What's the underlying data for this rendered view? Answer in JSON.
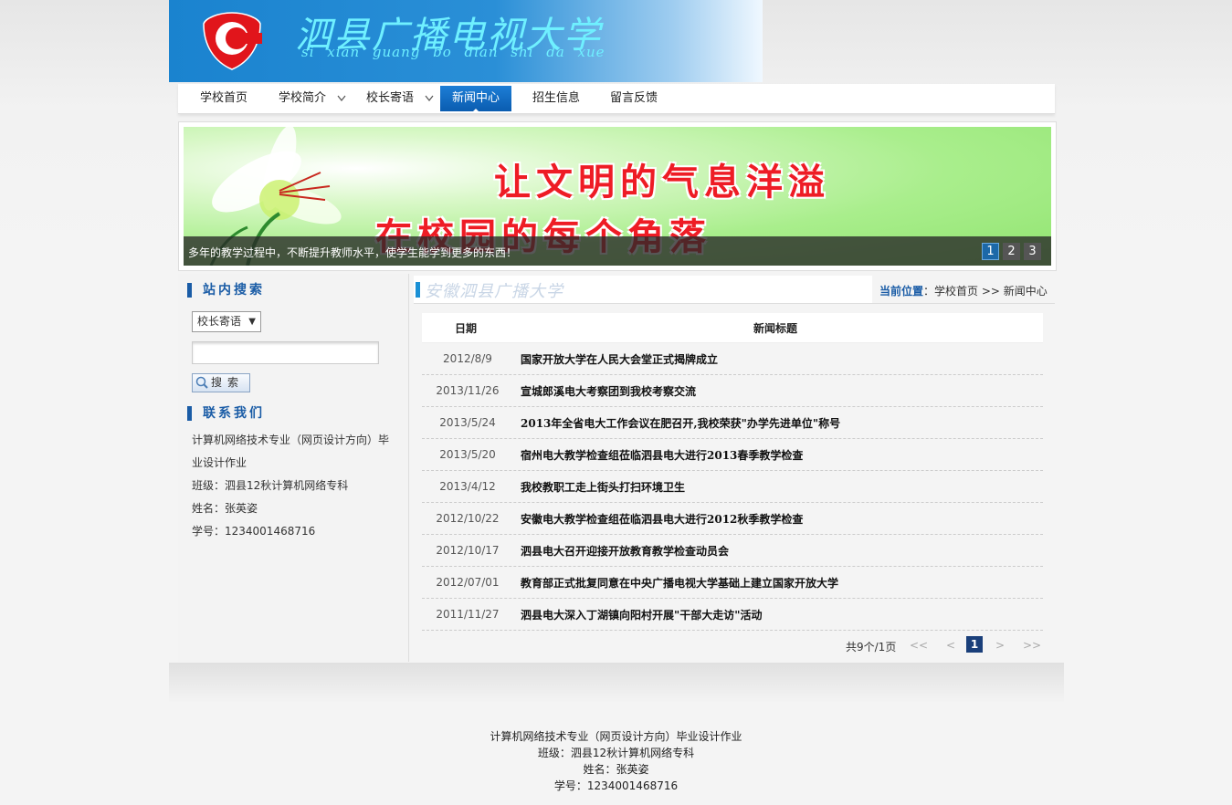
{
  "header": {
    "title": "泗县广播电视大学",
    "subtitle": "si xian guang bo dian shi da xue",
    "colors": {
      "brand_blue": "#1a83cf",
      "title_cyan": "#6ff0ff",
      "logo_red": "#e1151b"
    }
  },
  "nav": {
    "items": [
      {
        "label": "学校首页",
        "has_dropdown": false,
        "active": false
      },
      {
        "label": "学校简介",
        "has_dropdown": true,
        "active": false
      },
      {
        "label": "校长寄语",
        "has_dropdown": true,
        "active": false
      },
      {
        "label": "新闻中心",
        "has_dropdown": false,
        "active": true
      },
      {
        "label": "招生信息",
        "has_dropdown": false,
        "active": false
      },
      {
        "label": "留言反馈",
        "has_dropdown": false,
        "active": false
      }
    ]
  },
  "banner": {
    "line1": "让文明的气息洋溢",
    "line2": "在校园的每个角落",
    "caption": "多年的教学过程中，不断提升教师水平，使学生能学到更多的东西！",
    "pages": [
      "1",
      "2",
      "3"
    ],
    "current_page": "1"
  },
  "sidebar": {
    "search_heading": "站内搜索",
    "search_select_value": "校长寄语",
    "search_input_value": "",
    "search_button": "搜索",
    "contact_heading": "联系我们",
    "contact_lines": [
      "计算机网络技术专业（网页设计方向）毕",
      "业设计作业",
      "班级：泗县12秋计算机网络专科",
      "姓名：张英姿",
      "学号：1234001468716"
    ]
  },
  "main": {
    "header_title": "安徽泗县广播大学",
    "breadcrumb_label": "当前位置",
    "breadcrumb_path": "：学校首页 >> 新闻中心",
    "col_date": "日期",
    "col_title": "新闻标题",
    "news": [
      {
        "date": "2012/8/9",
        "title": "国家开放大学在人民大会堂正式揭牌成立"
      },
      {
        "date": "2013/11/26",
        "title": "宣城郎溪电大考察团到我校考察交流"
      },
      {
        "date": "2013/5/24",
        "title": "2013年全省电大工作会议在肥召开,我校荣获\"办学先进单位\"称号"
      },
      {
        "date": "2013/5/20",
        "title": "宿州电大教学检查组莅临泗县电大进行2013春季教学检查"
      },
      {
        "date": "2013/4/12",
        "title": "我校教职工走上街头打扫环境卫生"
      },
      {
        "date": "2012/10/22",
        "title": "安徽电大教学检查组莅临泗县电大进行2012秋季教学检查"
      },
      {
        "date": "2012/10/17",
        "title": "泗县电大召开迎接开放教育教学检查动员会"
      },
      {
        "date": "2012/07/01",
        "title": "教育部正式批复同意在中央广播电视大学基础上建立国家开放大学"
      },
      {
        "date": "2011/11/27",
        "title": "泗县电大深入丁湖镇向阳村开展\"干部大走访\"活动"
      }
    ],
    "pager": {
      "summary": "共9个/1页",
      "first": "<<",
      "prev": "<",
      "current": "1",
      "next": ">",
      "last": ">>"
    }
  },
  "footer": {
    "lines": [
      "计算机网络技术专业（网页设计方向）毕业设计作业",
      "班级：泗县12秋计算机网络专科",
      "姓名：张英姿",
      "学号：1234001468716"
    ]
  }
}
